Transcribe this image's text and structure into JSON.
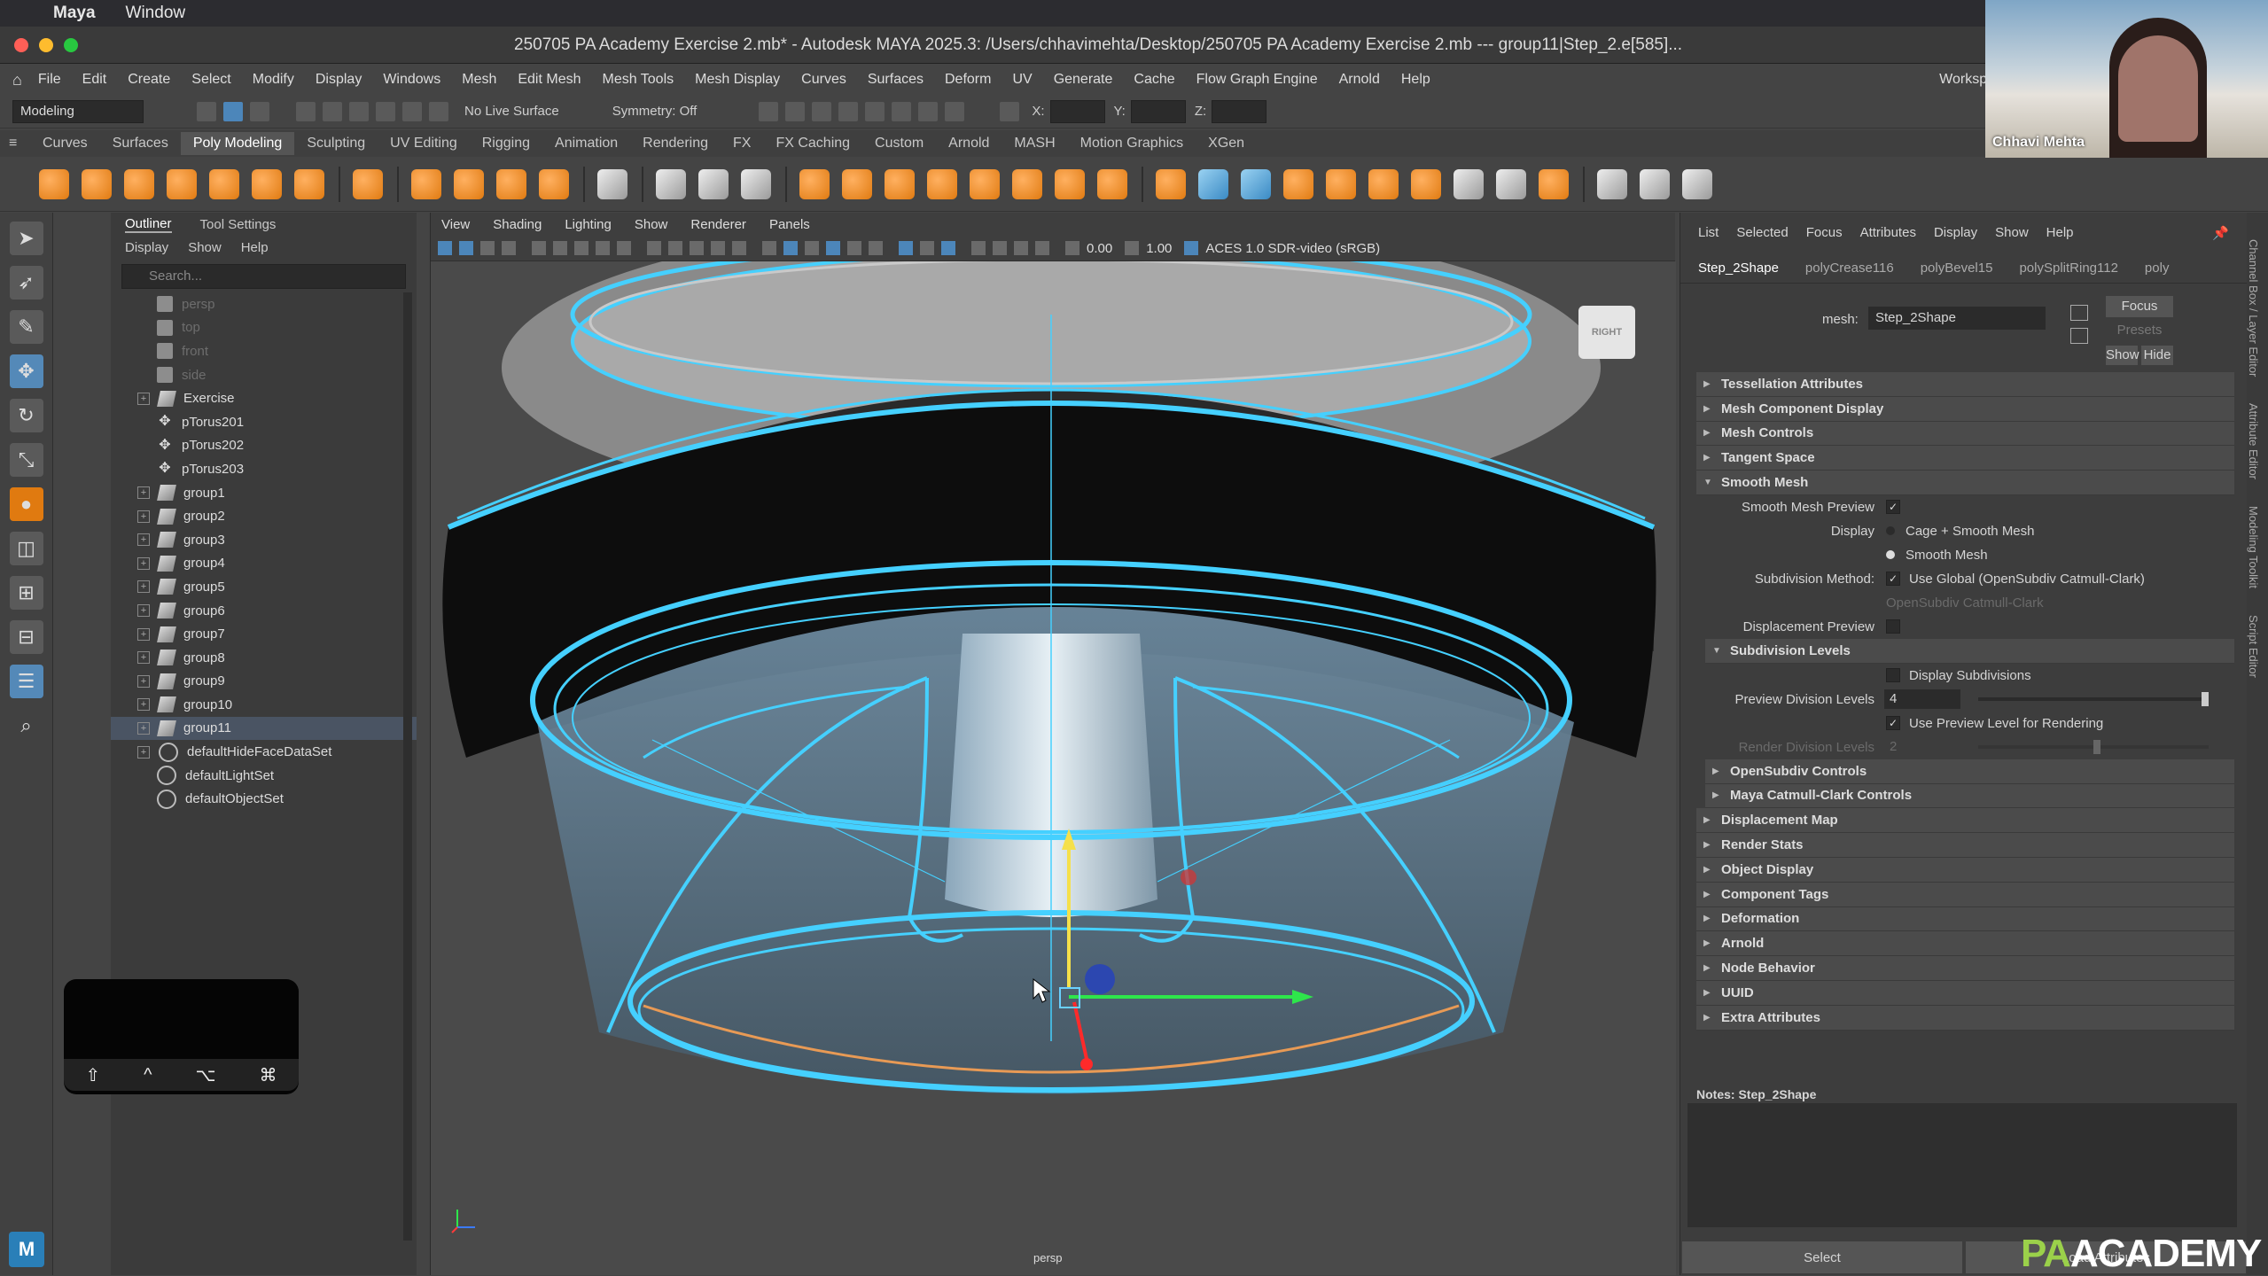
{
  "mac_menubar": {
    "app": "Maya",
    "items": [
      "Window"
    ]
  },
  "window": {
    "title": "250705 PA Academy Exercise 2.mb* - Autodesk MAYA 2025.3: /Users/chhavimehta/Desktop/250705 PA Academy Exercise 2.mb  ---  group11|Step_2.e[585]...",
    "traffic_colors": [
      "#ff5f57",
      "#febc2e",
      "#28c840"
    ]
  },
  "main_menu": {
    "items": [
      "File",
      "Edit",
      "Create",
      "Select",
      "Modify",
      "Display",
      "Windows",
      "Mesh",
      "Edit Mesh",
      "Mesh Tools",
      "Mesh Display",
      "Curves",
      "Surfaces",
      "Deform",
      "UV",
      "Generate",
      "Cache",
      "Flow Graph Engine",
      "Arnold",
      "Help"
    ],
    "workspace": "Workspac"
  },
  "status_line": {
    "mode": "Modeling",
    "live_surface": "No Live Surface",
    "symmetry": "Symmetry: Off",
    "x_label": "X:",
    "y_label": "Y:",
    "z_label": "Z:"
  },
  "shelf": {
    "tabs": [
      "Curves",
      "Surfaces",
      "Poly Modeling",
      "Sculpting",
      "UV Editing",
      "Rigging",
      "Animation",
      "Rendering",
      "FX",
      "FX Caching",
      "Custom",
      "Arnold",
      "MASH",
      "Motion Graphics",
      "XGen"
    ],
    "active_tab": "Poly Modeling"
  },
  "outliner": {
    "tabs": [
      "Outliner",
      "Tool Settings"
    ],
    "menu": [
      "Display",
      "Show",
      "Help"
    ],
    "search_placeholder": "Search...",
    "items": [
      {
        "label": "persp",
        "type": "camera",
        "dim": true
      },
      {
        "label": "top",
        "type": "camera",
        "dim": true
      },
      {
        "label": "front",
        "type": "camera",
        "dim": true
      },
      {
        "label": "side",
        "type": "camera",
        "dim": true
      },
      {
        "label": "Exercise",
        "type": "group",
        "expand": true
      },
      {
        "label": "pTorus201",
        "type": "mesh"
      },
      {
        "label": "pTorus202",
        "type": "mesh"
      },
      {
        "label": "pTorus203",
        "type": "mesh"
      },
      {
        "label": "group1",
        "type": "group",
        "expand": true
      },
      {
        "label": "group2",
        "type": "group",
        "expand": true
      },
      {
        "label": "group3",
        "type": "group",
        "expand": true
      },
      {
        "label": "group4",
        "type": "group",
        "expand": true
      },
      {
        "label": "group5",
        "type": "group",
        "expand": true
      },
      {
        "label": "group6",
        "type": "group",
        "expand": true
      },
      {
        "label": "group7",
        "type": "group",
        "expand": true
      },
      {
        "label": "group8",
        "type": "group",
        "expand": true
      },
      {
        "label": "group9",
        "type": "group",
        "expand": true
      },
      {
        "label": "group10",
        "type": "group",
        "expand": true
      },
      {
        "label": "group11",
        "type": "group",
        "expand": true,
        "selected": true
      },
      {
        "label": "defaultHideFaceDataSet",
        "type": "set",
        "expand": true
      },
      {
        "label": "defaultLightSet",
        "type": "set"
      },
      {
        "label": "defaultObjectSet",
        "type": "set"
      }
    ]
  },
  "keypad": {
    "keys": [
      "⇧",
      "^",
      "⌥",
      "⌘"
    ]
  },
  "viewport": {
    "menu": [
      "View",
      "Shading",
      "Lighting",
      "Show",
      "Renderer",
      "Panels"
    ],
    "exposure": "0.00",
    "gamma": "1.00",
    "color_space": "ACES 1.0 SDR-video (sRGB)",
    "camera_label": "persp",
    "view_cube": "RIGHT"
  },
  "attribute_editor": {
    "menu": [
      "List",
      "Selected",
      "Focus",
      "Attributes",
      "Display",
      "Show",
      "Help"
    ],
    "node_tabs": [
      "Step_2Shape",
      "polyCrease116",
      "polyBevel15",
      "polySplitRing112",
      "poly"
    ],
    "active_tab": "Step_2Shape",
    "mesh_label": "mesh:",
    "mesh_value": "Step_2Shape",
    "buttons": {
      "focus": "Focus",
      "presets": "Presets",
      "show": "Show",
      "hide": "Hide"
    },
    "sections_before": [
      "Tessellation Attributes",
      "Mesh Component Display",
      "Mesh Controls",
      "Tangent Space"
    ],
    "smooth_mesh": {
      "header": "Smooth Mesh",
      "preview_label": "Smooth Mesh Preview",
      "display_label": "Display",
      "display_opt1": "Cage + Smooth Mesh",
      "display_opt2": "Smooth Mesh",
      "subdiv_method_label": "Subdivision Method:",
      "subdiv_method_value": "Use Global (OpenSubdiv Catmull-Clark)",
      "subdiv_dim_value": "OpenSubdiv Catmull-Clark",
      "displacement_preview_label": "Displacement Preview",
      "subdiv_levels_header": "Subdivision Levels",
      "display_subdivisions": "Display Subdivisions",
      "preview_levels_label": "Preview Division Levels",
      "preview_levels_value": "4",
      "use_preview_rendering": "Use Preview Level for Rendering",
      "render_levels_label": "Render Division Levels",
      "render_levels_value": "2",
      "sub_sections": [
        "OpenSubdiv Controls",
        "Maya Catmull-Clark Controls"
      ]
    },
    "sections_after": [
      "Displacement Map",
      "Render Stats",
      "Object Display",
      "Component Tags",
      "Deformation",
      "Arnold",
      "Node Behavior",
      "UUID",
      "Extra Attributes"
    ],
    "notes_label": "Notes:  Step_2Shape",
    "footer": [
      "Select",
      "Load Attributes"
    ]
  },
  "side_tabs": [
    "Channel Box / Layer Editor",
    "Attribute Editor",
    "Modeling Toolkit",
    "Script Editor"
  ],
  "webcam": {
    "name": "Chhavi Mehta"
  },
  "watermark": {
    "pa": "PA",
    "rest": "ACADEMY"
  },
  "colors": {
    "wire_cyan": "#3fd3ff",
    "selection": "#4a5463",
    "maya_blue": "#5489b8",
    "shelf_orange": "#e07a10"
  }
}
